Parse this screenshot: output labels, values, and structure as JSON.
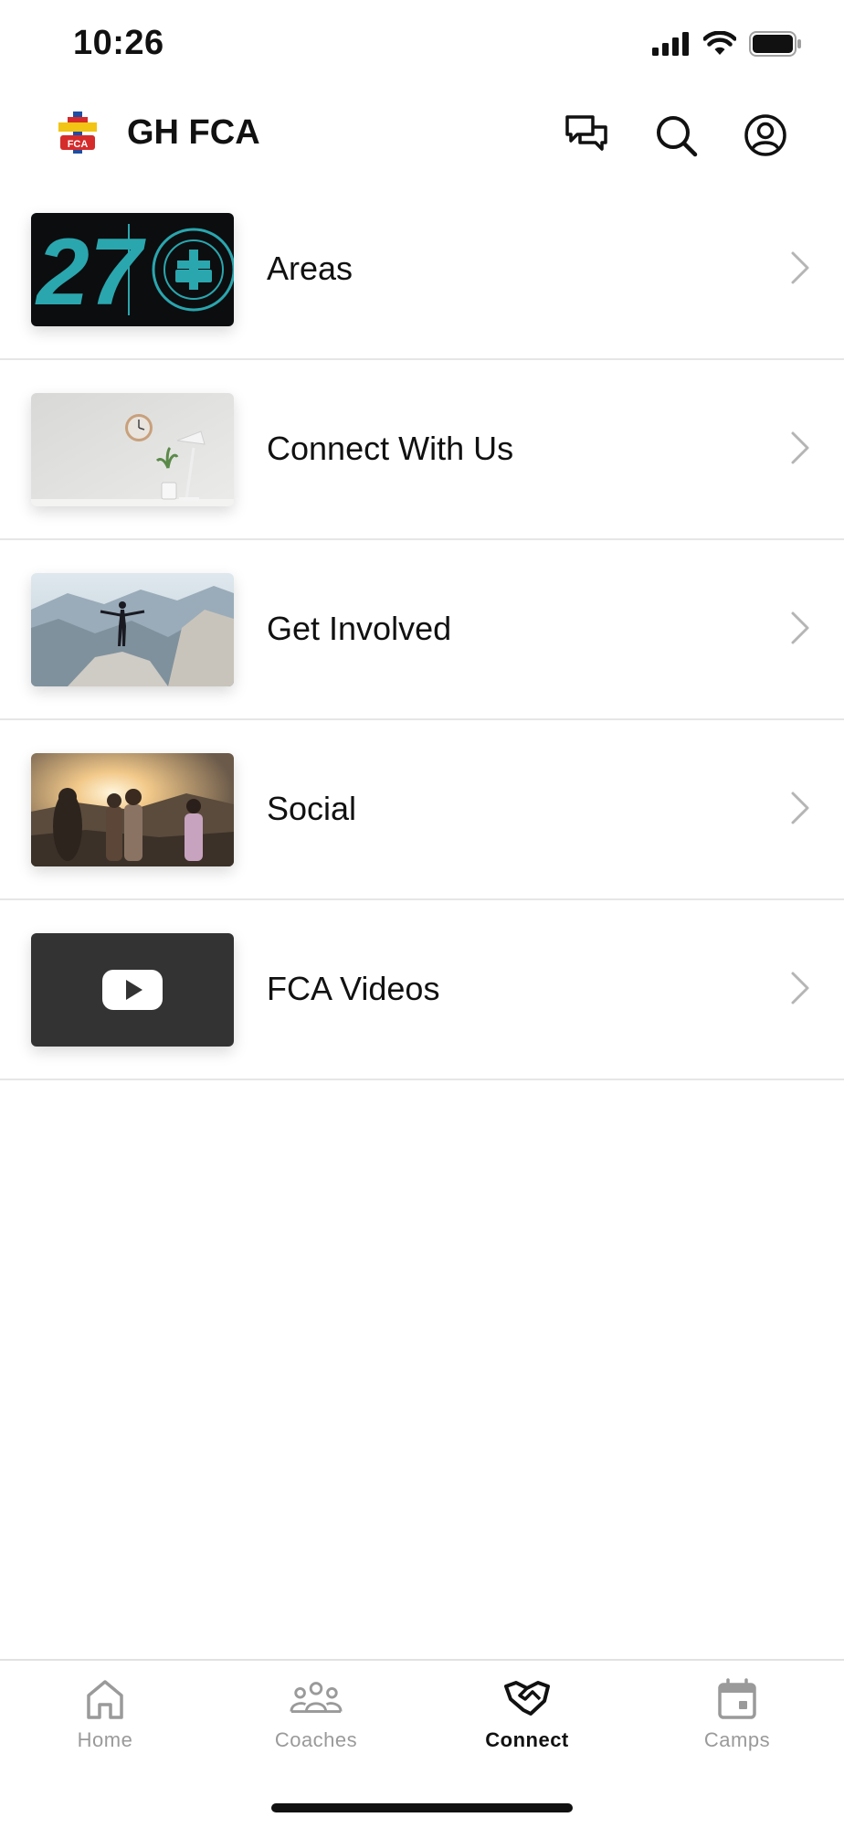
{
  "status_bar": {
    "time": "10:26"
  },
  "header": {
    "title": "GH FCA",
    "logo_text": "FCA",
    "icons": [
      "chat-icon",
      "search-icon",
      "profile-icon"
    ]
  },
  "menu": {
    "items": [
      {
        "label": "Areas",
        "thumb_text": "27"
      },
      {
        "label": "Connect With Us"
      },
      {
        "label": "Get Involved"
      },
      {
        "label": "Social"
      },
      {
        "label": "FCA Videos"
      }
    ]
  },
  "tabs": [
    {
      "label": "Home",
      "icon": "home-icon",
      "active": false
    },
    {
      "label": "Coaches",
      "icon": "group-icon",
      "active": false
    },
    {
      "label": "Connect",
      "icon": "handshake-icon",
      "active": true
    },
    {
      "label": "Camps",
      "icon": "calendar-icon",
      "active": false
    }
  ],
  "colors": {
    "accent": "#2aa6ae",
    "active_tab": "#111111",
    "inactive_tab": "#9a9a9a",
    "divider": "#e6e6e6"
  }
}
